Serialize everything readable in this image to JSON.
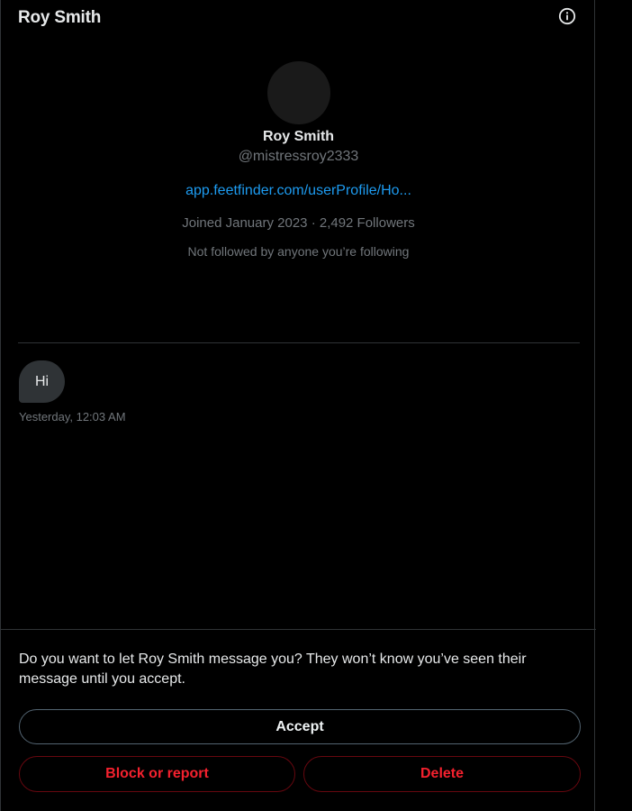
{
  "header": {
    "title": "Roy Smith",
    "info_icon": "info-circle-icon"
  },
  "profile": {
    "name": "Roy Smith",
    "handle": "@mistressroy2333",
    "link": "app.feetfinder.com/userProfile/Ho...",
    "meta": "Joined January 2023 · 2,492 Followers",
    "followed_by": "Not followed by anyone you’re following"
  },
  "messages": [
    {
      "text": "Hi",
      "timestamp": "Yesterday, 12:03 AM"
    }
  ],
  "request": {
    "prompt": "Do you want to let Roy Smith message you? They won’t know you’ve seen their message until you accept.",
    "accept_label": "Accept",
    "block_label": "Block or report",
    "delete_label": "Delete"
  },
  "colors": {
    "background": "#000000",
    "text": "#e7e9ea",
    "muted": "#71767b",
    "link": "#1d9bf0",
    "danger": "#f4212e",
    "bubble": "#2f3336"
  }
}
